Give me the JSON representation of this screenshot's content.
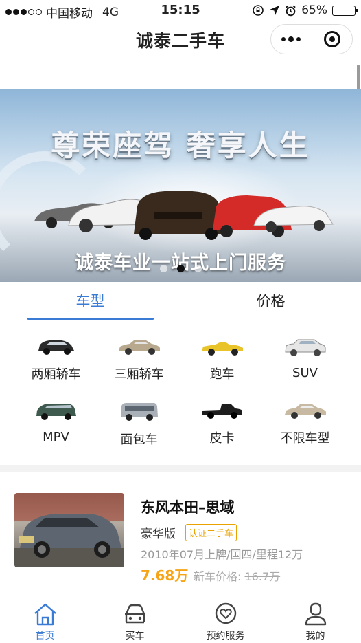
{
  "status_bar": {
    "carrier": "中国移动",
    "network": "4G",
    "time": "15:15",
    "battery": "65%",
    "battery_level": 0.65
  },
  "navbar": {
    "title": "诚泰二手车"
  },
  "banner": {
    "headline": "尊荣座驾  奢享人生",
    "subline": "诚泰车业一站式上门服务",
    "slide_count": 3,
    "active_slide": 1
  },
  "tabs": [
    {
      "label": "车型",
      "active": true
    },
    {
      "label": "价格",
      "active": false
    }
  ],
  "categories": [
    {
      "label": "两厢轿车",
      "icon": "hatchback-icon",
      "color": "#2b2b2b"
    },
    {
      "label": "三厢轿车",
      "icon": "sedan-icon",
      "color": "#b8a88e"
    },
    {
      "label": "跑车",
      "icon": "sports-car-icon",
      "color": "#e8c42a"
    },
    {
      "label": "SUV",
      "icon": "suv-icon",
      "color": "#e6e6e6"
    },
    {
      "label": "MPV",
      "icon": "mpv-icon",
      "color": "#3e5a4e"
    },
    {
      "label": "面包车",
      "icon": "van-icon",
      "color": "#a9b0b8"
    },
    {
      "label": "皮卡",
      "icon": "pickup-icon",
      "color": "#1d1d1d"
    },
    {
      "label": "不限车型",
      "icon": "any-car-icon",
      "color": "#c8b9a2"
    }
  ],
  "listing": {
    "name": "东风本田–思域",
    "trim": "豪华版",
    "badge": "认证二手车",
    "meta": "2010年07月上牌/国四/里程12万",
    "price": "7.68万",
    "new_price_label": "新车价格:",
    "new_price": "16.7万"
  },
  "tabbar": [
    {
      "label": "首页",
      "icon": "home-icon",
      "active": true
    },
    {
      "label": "买车",
      "icon": "car-icon",
      "active": false
    },
    {
      "label": "预约服务",
      "icon": "heart-badge-icon",
      "active": false
    },
    {
      "label": "我的",
      "icon": "user-icon",
      "active": false
    }
  ],
  "colors": {
    "accent": "#3a7bd5",
    "price": "#f7a516",
    "badge": "#e8a300"
  }
}
